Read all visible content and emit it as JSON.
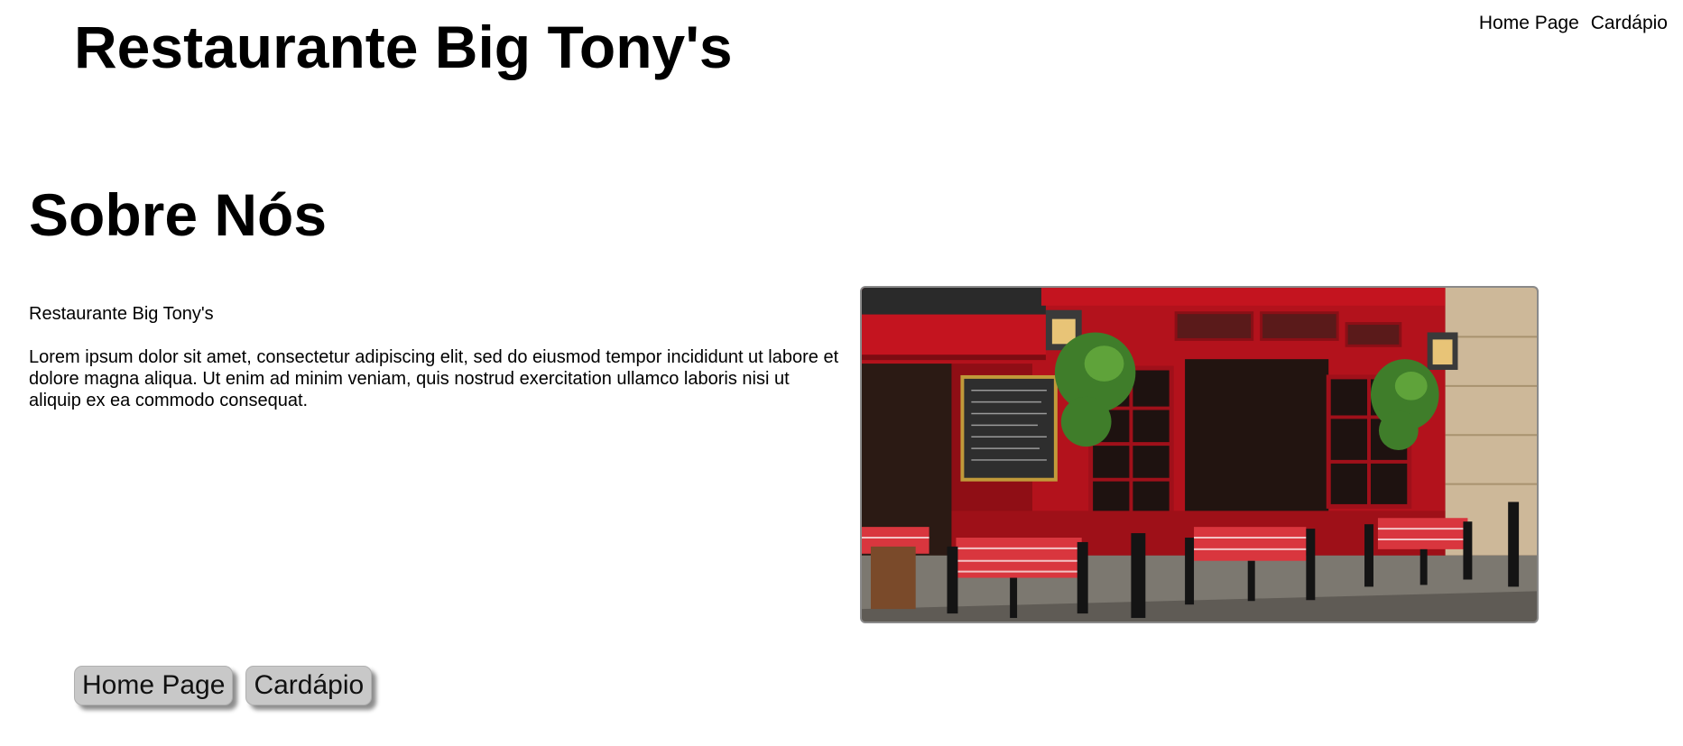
{
  "header": {
    "title": "Restaurante Big Tony's",
    "nav": [
      {
        "label": "Home Page"
      },
      {
        "label": "Cardápio"
      }
    ]
  },
  "main": {
    "section_title": "Sobre Nós",
    "restaurant_name": "Restaurante Big Tony's",
    "description": "Lorem ipsum dolor sit amet, consectetur adipiscing elit, sed do eiusmod tempor incididunt ut labore et dolore magna aliqua. Ut enim ad minim veniam, quis nostrud exercitation ullamco laboris nisi ut aliquip ex ea commodo consequat.",
    "photo_icon": "restaurant-storefront-photo"
  },
  "footer": {
    "buttons": [
      {
        "label": "Home Page"
      },
      {
        "label": "Cardápio"
      }
    ]
  },
  "colors": {
    "storefront_red": "#b3121c",
    "tablecloth_red": "#d9363e",
    "button_gray": "#c8c8c8"
  }
}
